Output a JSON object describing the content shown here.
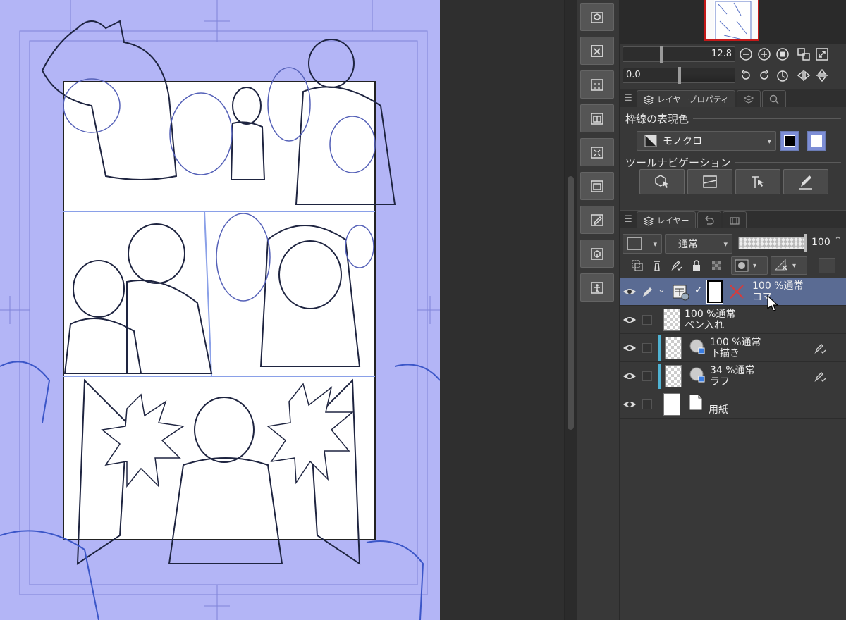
{
  "navigator": {
    "zoom_value": "12.8",
    "rotation_value": "0.0"
  },
  "property_tabs": {
    "layer_property": "レイヤープロパティ"
  },
  "layer_property": {
    "border_color_title": "枠線の表現色",
    "border_color_mode": "モノクロ",
    "tool_navigation_title": "ツールナビゲーション"
  },
  "layer_tabs": {
    "layer": "レイヤー"
  },
  "layer_panel": {
    "blend_mode": "通常",
    "opacity": "100",
    "layers": [
      {
        "name": "コマ",
        "meta": "100 %通常",
        "selected": true
      },
      {
        "name": "ペン入れ",
        "meta": "100 %通常",
        "selected": false
      },
      {
        "name": "下描き",
        "meta": "100 %通常",
        "selected": false
      },
      {
        "name": "ラフ",
        "meta": "34 %通常",
        "selected": false
      },
      {
        "name": "用紙",
        "meta": "",
        "selected": false
      }
    ]
  },
  "colors": {
    "canvas_bg": "#b3b5f6",
    "panel_bg": "#383838",
    "selected_row": "#5a6b93",
    "frame_border_x": "#c41a1a"
  }
}
